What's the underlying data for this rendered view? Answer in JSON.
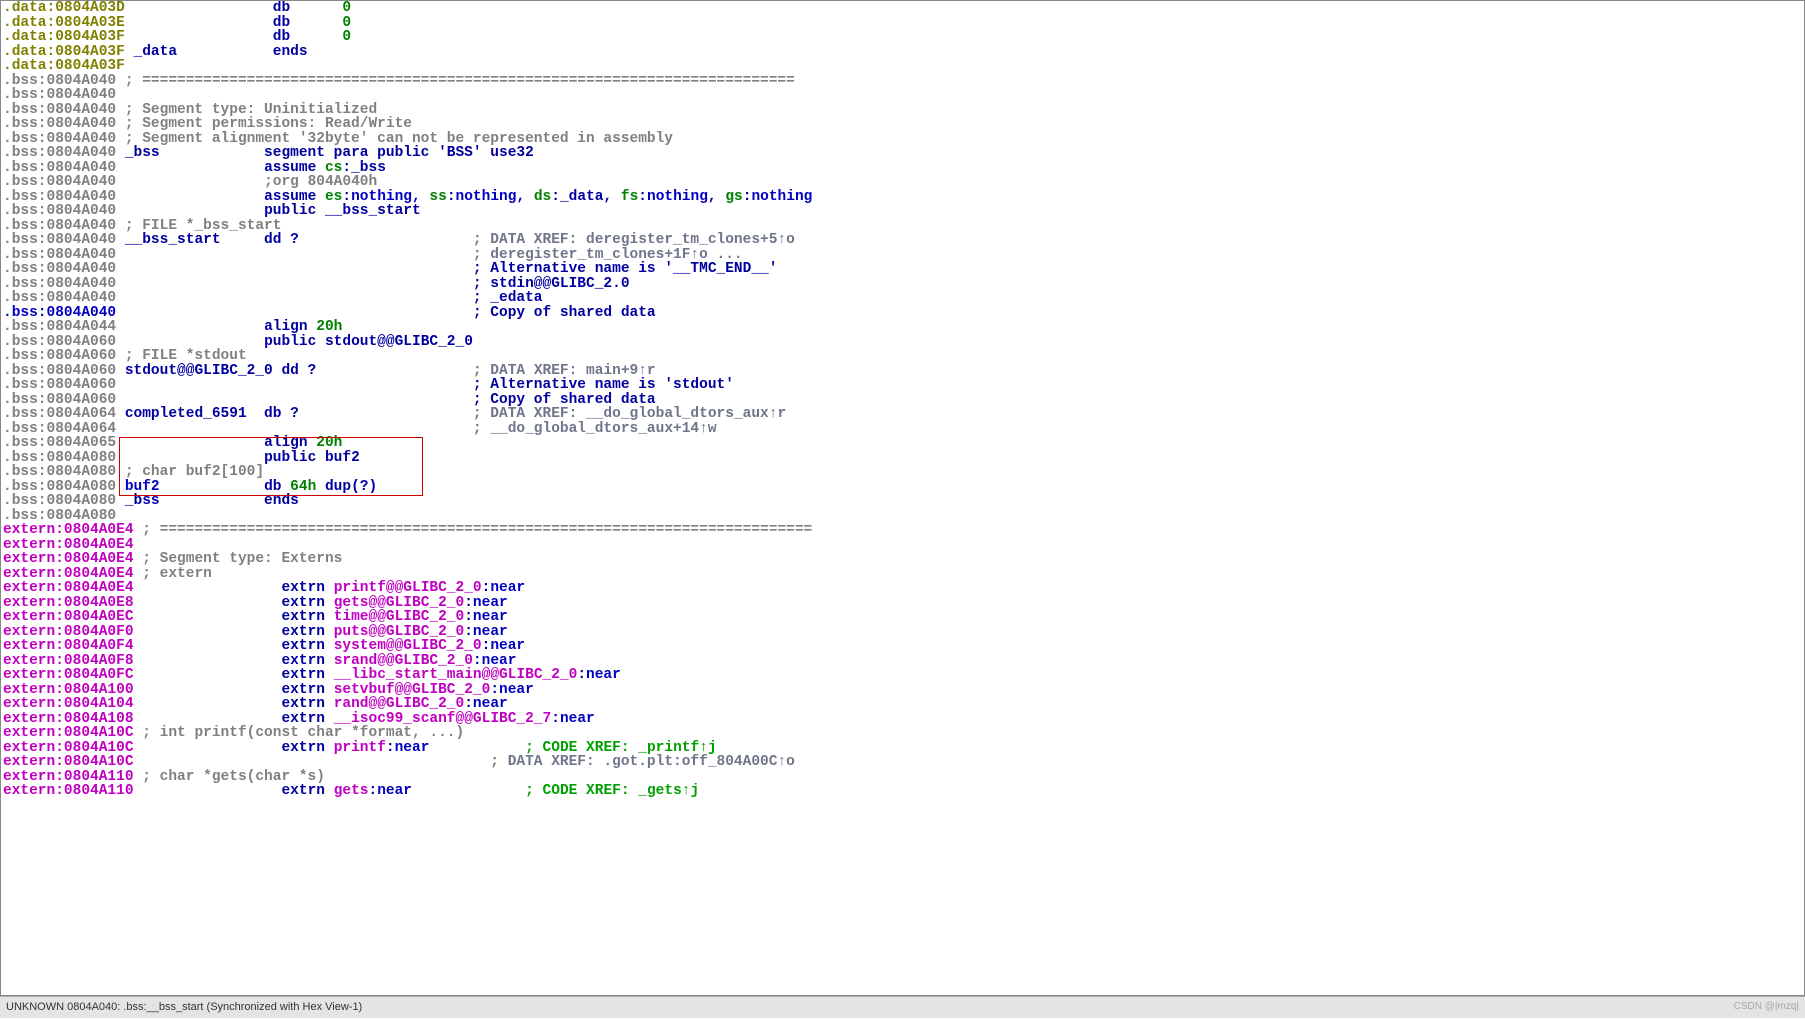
{
  "lines": [
    {
      "spans": [
        {
          "c": "c-olive",
          "t": ".data:0804A03D"
        },
        {
          "c": "",
          "t": "                 "
        },
        {
          "c": "c-navy",
          "t": "db      "
        },
        {
          "c": "c-green",
          "t": "0"
        }
      ]
    },
    {
      "spans": [
        {
          "c": "c-olive",
          "t": ".data:0804A03E"
        },
        {
          "c": "",
          "t": "                 "
        },
        {
          "c": "c-navy",
          "t": "db      "
        },
        {
          "c": "c-green",
          "t": "0"
        }
      ]
    },
    {
      "spans": [
        {
          "c": "c-olive",
          "t": ".data:0804A03F"
        },
        {
          "c": "",
          "t": "                 "
        },
        {
          "c": "c-navy",
          "t": "db      "
        },
        {
          "c": "c-green",
          "t": "0"
        }
      ]
    },
    {
      "spans": [
        {
          "c": "c-olive",
          "t": ".data:0804A03F "
        },
        {
          "c": "c-navy",
          "t": "_data           ends"
        }
      ]
    },
    {
      "spans": [
        {
          "c": "c-olive",
          "t": ".data:0804A03F"
        }
      ]
    },
    {
      "spans": [
        {
          "c": "c-gray",
          "t": ".bss:0804A040 ; ==========================================================================="
        }
      ]
    },
    {
      "spans": [
        {
          "c": "c-gray",
          "t": ".bss:0804A040"
        }
      ]
    },
    {
      "spans": [
        {
          "c": "c-gray",
          "t": ".bss:0804A040 ; Segment type: Uninitialized"
        }
      ]
    },
    {
      "spans": [
        {
          "c": "c-gray",
          "t": ".bss:0804A040 ; Segment permissions: Read/Write"
        }
      ]
    },
    {
      "spans": [
        {
          "c": "c-gray",
          "t": ".bss:0804A040 ; Segment alignment '32byte' can not be represented in assembly"
        }
      ]
    },
    {
      "spans": [
        {
          "c": "c-gray",
          "t": ".bss:0804A040 "
        },
        {
          "c": "c-navy",
          "t": "_bss            segment para public 'BSS' use32"
        }
      ]
    },
    {
      "spans": [
        {
          "c": "c-gray",
          "t": ".bss:0804A040"
        },
        {
          "c": "",
          "t": "                 "
        },
        {
          "c": "c-navy",
          "t": "assume "
        },
        {
          "c": "c-green",
          "t": "cs"
        },
        {
          "c": "c-navy",
          "t": ":_bss"
        }
      ]
    },
    {
      "spans": [
        {
          "c": "c-gray",
          "t": ".bss:0804A040"
        },
        {
          "c": "",
          "t": "                 "
        },
        {
          "c": "c-gray",
          "t": ";org 804A040h"
        }
      ]
    },
    {
      "spans": [
        {
          "c": "c-gray",
          "t": ".bss:0804A040"
        },
        {
          "c": "",
          "t": "                 "
        },
        {
          "c": "c-navy",
          "t": "assume "
        },
        {
          "c": "c-green",
          "t": "es"
        },
        {
          "c": "c-navy",
          "t": ":"
        },
        {
          "c": "c-boldnavy",
          "t": "nothing"
        },
        {
          "c": "c-navy",
          "t": ", "
        },
        {
          "c": "c-green",
          "t": "ss"
        },
        {
          "c": "c-navy",
          "t": ":"
        },
        {
          "c": "c-boldnavy",
          "t": "nothing"
        },
        {
          "c": "c-navy",
          "t": ", "
        },
        {
          "c": "c-green",
          "t": "ds"
        },
        {
          "c": "c-navy",
          "t": ":_data, "
        },
        {
          "c": "c-green",
          "t": "fs"
        },
        {
          "c": "c-navy",
          "t": ":"
        },
        {
          "c": "c-boldnavy",
          "t": "nothing"
        },
        {
          "c": "c-navy",
          "t": ", "
        },
        {
          "c": "c-green",
          "t": "gs"
        },
        {
          "c": "c-navy",
          "t": ":"
        },
        {
          "c": "c-boldnavy",
          "t": "nothing"
        }
      ]
    },
    {
      "spans": [
        {
          "c": "c-gray",
          "t": ".bss:0804A040"
        },
        {
          "c": "",
          "t": "                 "
        },
        {
          "c": "c-navy",
          "t": "public __bss_start"
        }
      ]
    },
    {
      "spans": [
        {
          "c": "c-gray",
          "t": ".bss:0804A040 ; FILE *_bss_start"
        }
      ]
    },
    {
      "spans": [
        {
          "c": "c-gray",
          "t": ".bss:0804A040 "
        },
        {
          "c": "c-navy",
          "t": "__bss_start     dd ?"
        },
        {
          "c": "",
          "t": "                    "
        },
        {
          "c": "c-grayblue",
          "t": "; DATA XREF: deregister_tm_clones+5↑o"
        }
      ]
    },
    {
      "spans": [
        {
          "c": "c-gray",
          "t": ".bss:0804A040"
        },
        {
          "c": "",
          "t": "                                         "
        },
        {
          "c": "c-grayblue",
          "t": "; deregister_tm_clones+1F↑o ..."
        }
      ]
    },
    {
      "spans": [
        {
          "c": "c-gray",
          "t": ".bss:0804A040"
        },
        {
          "c": "",
          "t": "                                         "
        },
        {
          "c": "c-navy",
          "t": "; Alternative name is '__TMC_END__'"
        }
      ]
    },
    {
      "spans": [
        {
          "c": "c-gray",
          "t": ".bss:0804A040"
        },
        {
          "c": "",
          "t": "                                         "
        },
        {
          "c": "c-navy",
          "t": "; stdin@@GLIBC_2.0"
        }
      ]
    },
    {
      "spans": [
        {
          "c": "c-gray",
          "t": ".bss:0804A040"
        },
        {
          "c": "",
          "t": "                                         "
        },
        {
          "c": "c-navy",
          "t": "; _edata"
        }
      ]
    },
    {
      "spans": [
        {
          "c": "c-boldnavy",
          "t": ".bss:0804A040"
        },
        {
          "c": "",
          "t": "                                         "
        },
        {
          "c": "c-navy",
          "t": "; Copy of shared data"
        }
      ]
    },
    {
      "spans": [
        {
          "c": "c-gray",
          "t": ".bss:0804A044"
        },
        {
          "c": "",
          "t": "                 "
        },
        {
          "c": "c-navy",
          "t": "align "
        },
        {
          "c": "c-green",
          "t": "20h"
        }
      ]
    },
    {
      "spans": [
        {
          "c": "c-gray",
          "t": ".bss:0804A060"
        },
        {
          "c": "",
          "t": "                 "
        },
        {
          "c": "c-navy",
          "t": "public stdout@@GLIBC_2_0"
        }
      ]
    },
    {
      "spans": [
        {
          "c": "c-gray",
          "t": ".bss:0804A060 ; FILE *stdout"
        }
      ]
    },
    {
      "spans": [
        {
          "c": "c-gray",
          "t": ".bss:0804A060 "
        },
        {
          "c": "c-navy",
          "t": "stdout@@GLIBC_2_0 dd ?"
        },
        {
          "c": "",
          "t": "                  "
        },
        {
          "c": "c-grayblue",
          "t": "; DATA XREF: main+9↑r"
        }
      ]
    },
    {
      "spans": [
        {
          "c": "c-gray",
          "t": ".bss:0804A060"
        },
        {
          "c": "",
          "t": "                                         "
        },
        {
          "c": "c-navy",
          "t": "; Alternative name is 'stdout'"
        }
      ]
    },
    {
      "spans": [
        {
          "c": "c-gray",
          "t": ".bss:0804A060"
        },
        {
          "c": "",
          "t": "                                         "
        },
        {
          "c": "c-navy",
          "t": "; Copy of shared data"
        }
      ]
    },
    {
      "spans": [
        {
          "c": "c-gray",
          "t": ".bss:0804A064 "
        },
        {
          "c": "c-navy",
          "t": "completed_6591  db ?"
        },
        {
          "c": "",
          "t": "                    "
        },
        {
          "c": "c-grayblue",
          "t": "; DATA XREF: __do_global_dtors_aux↑r"
        }
      ]
    },
    {
      "spans": [
        {
          "c": "c-gray",
          "t": ".bss:0804A064"
        },
        {
          "c": "",
          "t": "                                         "
        },
        {
          "c": "c-grayblue",
          "t": "; __do_global_dtors_aux+14↑w"
        }
      ]
    },
    {
      "spans": [
        {
          "c": "c-gray",
          "t": ".bss:0804A065"
        },
        {
          "c": "",
          "t": "                 "
        },
        {
          "c": "c-navy",
          "t": "align "
        },
        {
          "c": "c-green",
          "t": "20h"
        }
      ]
    },
    {
      "spans": [
        {
          "c": "c-gray",
          "t": ".bss:0804A080"
        },
        {
          "c": "",
          "t": "                 "
        },
        {
          "c": "c-navy",
          "t": "public buf2"
        }
      ]
    },
    {
      "spans": [
        {
          "c": "c-gray",
          "t": ".bss:0804A080 ; char buf2[100]"
        }
      ]
    },
    {
      "spans": [
        {
          "c": "c-gray",
          "t": ".bss:0804A080 "
        },
        {
          "c": "c-boldnavy",
          "t": "buf2"
        },
        {
          "c": "",
          "t": "            "
        },
        {
          "c": "c-navy",
          "t": "db "
        },
        {
          "c": "c-green",
          "t": "64h"
        },
        {
          "c": "c-navy",
          "t": " dup(?)"
        }
      ]
    },
    {
      "spans": [
        {
          "c": "c-gray",
          "t": ".bss:0804A080 "
        },
        {
          "c": "c-navy",
          "t": "_bss            ends"
        }
      ]
    },
    {
      "spans": [
        {
          "c": "c-gray",
          "t": ".bss:0804A080"
        }
      ]
    },
    {
      "spans": [
        {
          "c": "c-magenta",
          "t": "extern:0804A0E4 "
        },
        {
          "c": "c-gray",
          "t": "; ==========================================================================="
        }
      ]
    },
    {
      "spans": [
        {
          "c": "c-magenta",
          "t": "extern:0804A0E4"
        }
      ]
    },
    {
      "spans": [
        {
          "c": "c-magenta",
          "t": "extern:0804A0E4 "
        },
        {
          "c": "c-gray",
          "t": "; Segment type: Externs"
        }
      ]
    },
    {
      "spans": [
        {
          "c": "c-magenta",
          "t": "extern:0804A0E4 "
        },
        {
          "c": "c-gray",
          "t": "; extern"
        }
      ]
    },
    {
      "spans": [
        {
          "c": "c-magenta",
          "t": "extern:0804A0E4"
        },
        {
          "c": "",
          "t": "                 "
        },
        {
          "c": "c-navy",
          "t": "extrn "
        },
        {
          "c": "c-magenta",
          "t": "printf@@GLIBC_2_0"
        },
        {
          "c": "c-navy",
          "t": ":"
        },
        {
          "c": "c-boldnavy",
          "t": "near"
        }
      ]
    },
    {
      "spans": [
        {
          "c": "c-magenta",
          "t": "extern:0804A0E8"
        },
        {
          "c": "",
          "t": "                 "
        },
        {
          "c": "c-navy",
          "t": "extrn "
        },
        {
          "c": "c-magenta",
          "t": "gets@@GLIBC_2_0"
        },
        {
          "c": "c-navy",
          "t": ":"
        },
        {
          "c": "c-boldnavy",
          "t": "near"
        }
      ]
    },
    {
      "spans": [
        {
          "c": "c-magenta",
          "t": "extern:0804A0EC"
        },
        {
          "c": "",
          "t": "                 "
        },
        {
          "c": "c-navy",
          "t": "extrn "
        },
        {
          "c": "c-magenta",
          "t": "time@@GLIBC_2_0"
        },
        {
          "c": "c-navy",
          "t": ":"
        },
        {
          "c": "c-boldnavy",
          "t": "near"
        }
      ]
    },
    {
      "spans": [
        {
          "c": "c-magenta",
          "t": "extern:0804A0F0"
        },
        {
          "c": "",
          "t": "                 "
        },
        {
          "c": "c-navy",
          "t": "extrn "
        },
        {
          "c": "c-magenta",
          "t": "puts@@GLIBC_2_0"
        },
        {
          "c": "c-navy",
          "t": ":"
        },
        {
          "c": "c-boldnavy",
          "t": "near"
        }
      ]
    },
    {
      "spans": [
        {
          "c": "c-magenta",
          "t": "extern:0804A0F4"
        },
        {
          "c": "",
          "t": "                 "
        },
        {
          "c": "c-navy",
          "t": "extrn "
        },
        {
          "c": "c-magenta",
          "t": "system@@GLIBC_2_0"
        },
        {
          "c": "c-navy",
          "t": ":"
        },
        {
          "c": "c-boldnavy",
          "t": "near"
        }
      ]
    },
    {
      "spans": [
        {
          "c": "c-magenta",
          "t": "extern:0804A0F8"
        },
        {
          "c": "",
          "t": "                 "
        },
        {
          "c": "c-navy",
          "t": "extrn "
        },
        {
          "c": "c-magenta",
          "t": "srand@@GLIBC_2_0"
        },
        {
          "c": "c-navy",
          "t": ":"
        },
        {
          "c": "c-boldnavy",
          "t": "near"
        }
      ]
    },
    {
      "spans": [
        {
          "c": "c-magenta",
          "t": "extern:0804A0FC"
        },
        {
          "c": "",
          "t": "                 "
        },
        {
          "c": "c-navy",
          "t": "extrn "
        },
        {
          "c": "c-magenta",
          "t": "__libc_start_main@@GLIBC_2_0"
        },
        {
          "c": "c-navy",
          "t": ":"
        },
        {
          "c": "c-boldnavy",
          "t": "near"
        }
      ]
    },
    {
      "spans": [
        {
          "c": "c-magenta",
          "t": "extern:0804A100"
        },
        {
          "c": "",
          "t": "                 "
        },
        {
          "c": "c-navy",
          "t": "extrn "
        },
        {
          "c": "c-magenta",
          "t": "setvbuf@@GLIBC_2_0"
        },
        {
          "c": "c-navy",
          "t": ":"
        },
        {
          "c": "c-boldnavy",
          "t": "near"
        }
      ]
    },
    {
      "spans": [
        {
          "c": "c-magenta",
          "t": "extern:0804A104"
        },
        {
          "c": "",
          "t": "                 "
        },
        {
          "c": "c-navy",
          "t": "extrn "
        },
        {
          "c": "c-magenta",
          "t": "rand@@GLIBC_2_0"
        },
        {
          "c": "c-navy",
          "t": ":"
        },
        {
          "c": "c-boldnavy",
          "t": "near"
        }
      ]
    },
    {
      "spans": [
        {
          "c": "c-magenta",
          "t": "extern:0804A108"
        },
        {
          "c": "",
          "t": "                 "
        },
        {
          "c": "c-navy",
          "t": "extrn "
        },
        {
          "c": "c-magenta",
          "t": "__isoc99_scanf@@GLIBC_2_7"
        },
        {
          "c": "c-navy",
          "t": ":"
        },
        {
          "c": "c-boldnavy",
          "t": "near"
        }
      ]
    },
    {
      "spans": [
        {
          "c": "c-magenta",
          "t": "extern:0804A10C "
        },
        {
          "c": "c-gray",
          "t": "; int printf(const char *format, ...)"
        }
      ]
    },
    {
      "spans": [
        {
          "c": "c-magenta",
          "t": "extern:0804A10C"
        },
        {
          "c": "",
          "t": "                 "
        },
        {
          "c": "c-navy",
          "t": "extrn "
        },
        {
          "c": "c-magenta",
          "t": "printf"
        },
        {
          "c": "c-navy",
          "t": ":"
        },
        {
          "c": "c-boldnavy",
          "t": "near"
        },
        {
          "c": "",
          "t": "           "
        },
        {
          "c": "c-lime",
          "t": "; CODE XREF: _printf↑j"
        }
      ]
    },
    {
      "spans": [
        {
          "c": "c-magenta",
          "t": "extern:0804A10C"
        },
        {
          "c": "",
          "t": "                                         "
        },
        {
          "c": "c-grayblue",
          "t": "; DATA XREF: .got.plt:off_804A00C↑o"
        }
      ]
    },
    {
      "spans": [
        {
          "c": "c-magenta",
          "t": "extern:0804A110 "
        },
        {
          "c": "c-gray",
          "t": "; char *gets(char *s)"
        }
      ]
    },
    {
      "spans": [
        {
          "c": "c-magenta",
          "t": "extern:0804A110"
        },
        {
          "c": "",
          "t": "                 "
        },
        {
          "c": "c-navy",
          "t": "extrn "
        },
        {
          "c": "c-magenta",
          "t": "gets"
        },
        {
          "c": "c-navy",
          "t": ":"
        },
        {
          "c": "c-boldnavy",
          "t": "near"
        },
        {
          "c": "",
          "t": "             "
        },
        {
          "c": "c-lime",
          "t": "; CODE XREF: _gets↑j"
        }
      ]
    }
  ],
  "statusbar": {
    "text": "UNKNOWN  0804A040: .bss:__bss_start  (Synchronized with Hex View-1)",
    "watermark": "CSDN @|mzq|"
  }
}
